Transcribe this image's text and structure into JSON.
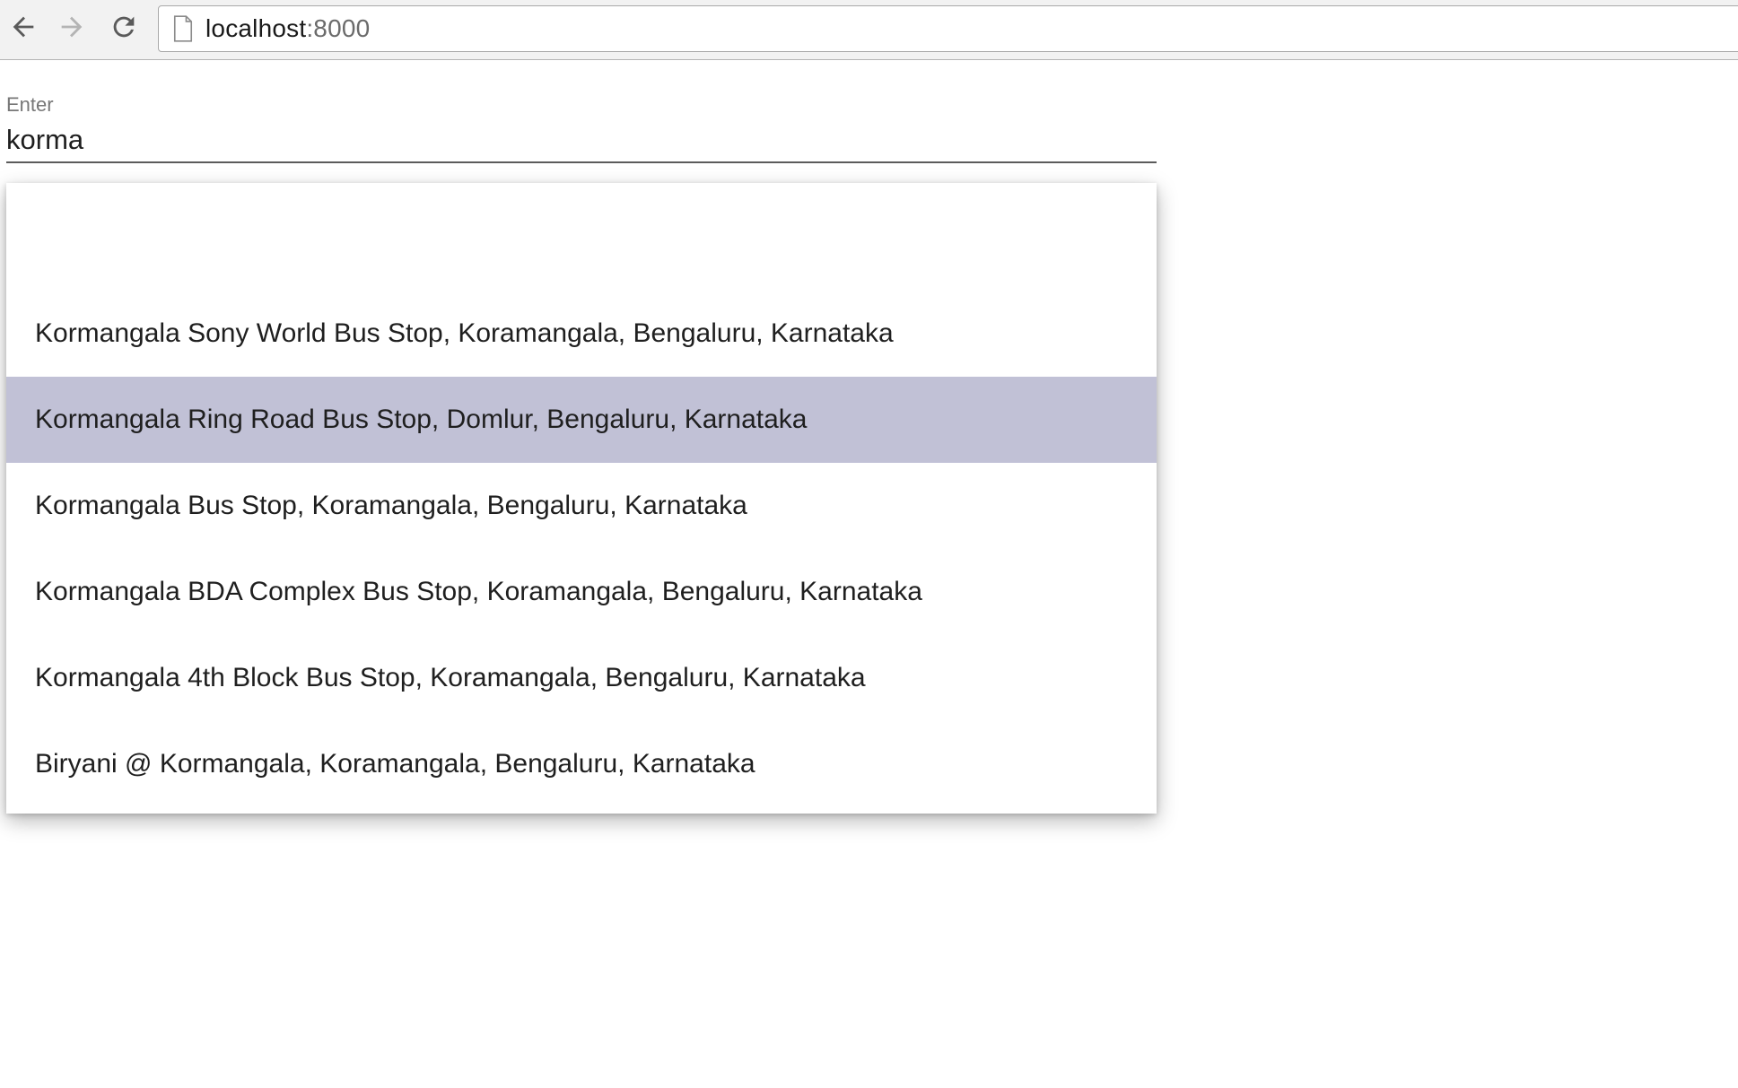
{
  "browser": {
    "url_host": "localhost",
    "url_port": ":8000",
    "icons": {
      "back": "arrow-left-icon",
      "forward": "arrow-right-icon",
      "reload": "reload-icon",
      "page": "document-icon"
    }
  },
  "form": {
    "label": "Enter",
    "value": "korma"
  },
  "autocomplete": {
    "highlight_color": "#c1c1d6",
    "highlighted_index": 1,
    "options": [
      "Kormangala Sony World Bus Stop, Koramangala, Bengaluru, Karnataka",
      "Kormangala Ring Road Bus Stop, Domlur, Bengaluru, Karnataka",
      "Kormangala Bus Stop, Koramangala, Bengaluru, Karnataka",
      "Kormangala BDA Complex Bus Stop, Koramangala, Bengaluru, Karnataka",
      "Kormangala 4th Block Bus Stop, Koramangala, Bengaluru, Karnataka",
      "Biryani @ Kormangala, Koramangala, Bengaluru, Karnataka"
    ]
  }
}
